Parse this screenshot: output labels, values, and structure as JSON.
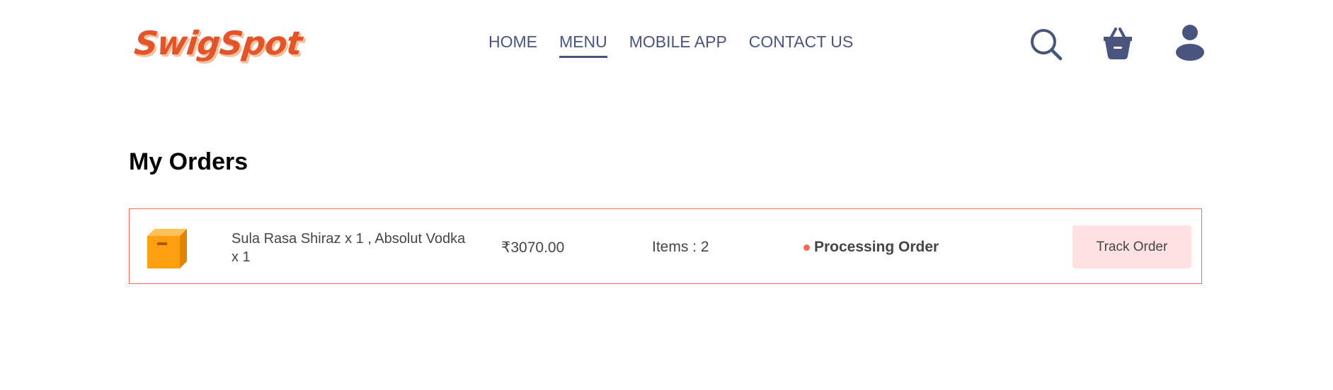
{
  "header": {
    "logo_text": "SwigSpot",
    "nav": [
      {
        "label": "HOME",
        "active": false
      },
      {
        "label": "MENU",
        "active": true
      },
      {
        "label": "MOBILE APP",
        "active": false
      },
      {
        "label": "CONTACT US",
        "active": false
      }
    ],
    "icons": [
      "search-icon",
      "basket-icon",
      "profile-icon"
    ]
  },
  "main": {
    "title": "My Orders",
    "orders": [
      {
        "icon": "parcel-icon",
        "items": "Sula Rasa Shiraz x 1 , Absolut Vodka x 1",
        "amount": "₹3070.00",
        "item_count": "Items : 2",
        "status": "Processing Order",
        "action_label": "Track Order"
      }
    ]
  },
  "colors": {
    "brand": "#e2542a",
    "nav_text": "#49557e",
    "accent": "#f26a53",
    "button_bg": "#ffe1e1",
    "body_text": "#454545"
  }
}
